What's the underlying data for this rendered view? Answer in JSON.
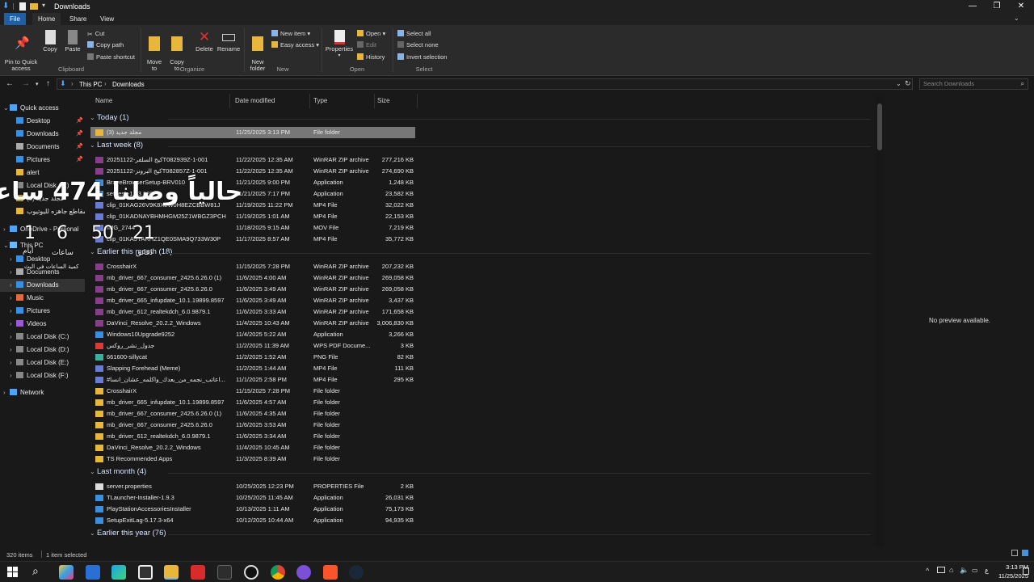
{
  "window": {
    "title": "Downloads"
  },
  "ribbon_tabs": [
    "File",
    "Home",
    "Share",
    "View"
  ],
  "ribbon": {
    "clipboard": {
      "group": "Clipboard",
      "pin": "Pin to Quick\naccess",
      "copy": "Copy",
      "paste": "Paste",
      "cut": "Cut",
      "copy_path": "Copy path",
      "paste_shortcut": "Paste shortcut"
    },
    "organize": {
      "group": "Organize",
      "move_to": "Move\nto",
      "copy_to": "Copy\nto",
      "delete": "Delete",
      "rename": "Rename"
    },
    "new": {
      "group": "New",
      "new_folder": "New\nfolder",
      "new_item": "New item",
      "easy_access": "Easy access"
    },
    "open": {
      "group": "Open",
      "properties": "Properties",
      "open": "Open",
      "edit": "Edit",
      "history": "History"
    },
    "select": {
      "group": "Select",
      "select_all": "Select all",
      "select_none": "Select none",
      "invert": "Invert selection"
    }
  },
  "address": {
    "path": [
      "This PC",
      "Downloads"
    ],
    "search_placeholder": "Search Downloads"
  },
  "nav": {
    "quick_access": "Quick access",
    "quick_items": [
      "Desktop",
      "Downloads",
      "Documents",
      "Pictures",
      "alert",
      "Local Disk (D:)",
      "مجلد جديد (3)",
      "مقاطع جاهزه لليوتيوب"
    ],
    "onedrive": "OneDrive - Personal",
    "this_pc": "This PC",
    "pc_items": [
      "Desktop",
      "Documents",
      "Downloads",
      "Music",
      "Pictures",
      "Videos",
      "Local Disk (C:)",
      "Local Disk (D:)",
      "Local Disk (E:)",
      "Local Disk (F:)"
    ],
    "network": "Network"
  },
  "columns": [
    "Name",
    "Date modified",
    "Type",
    "Size"
  ],
  "groups": [
    {
      "label": "Today (1)",
      "rows": [
        [
          "مجلد جديد (3)",
          "11/25/2025 3:13 PM",
          "File folder",
          ""
        ]
      ]
    },
    {
      "label": "Last week (8)",
      "rows": [
        [
          "20251122-كيج السلفرT082939Z-1-001",
          "11/22/2025 12:35 AM",
          "WinRAR ZIP archive",
          "277,216 KB"
        ],
        [
          "20251122-كيج البرونزT082857Z-1-001",
          "11/22/2025 12:35 AM",
          "WinRAR ZIP archive",
          "274,690 KB"
        ],
        [
          "BraveBrowserSetup-BRV010",
          "11/21/2025 9:00 PM",
          "Application",
          "1,248 KB"
        ],
        [
          "setdesk-1.23.386",
          "11/21/2025 7:17 PM",
          "Application",
          "23,582 KB"
        ],
        [
          "clip_01KAG26V9K8X2W0H8EZCBBW81J",
          "11/19/2025 11:22 PM",
          "MP4 File",
          "32,022 KB"
        ],
        [
          "clip_01KADNAYBHMHGM25Z1WBGZ3PCH",
          "11/19/2025 1:01 AM",
          "MP4 File",
          "22,153 KB"
        ],
        [
          "IMG_2744",
          "11/18/2025 9:15 AM",
          "MOV File",
          "7,219 KB"
        ],
        [
          "clip_01KA5YARHZ1QE0SMA9Q733W30P",
          "11/17/2025 8:57 AM",
          "MP4 File",
          "35,772 KB"
        ]
      ]
    },
    {
      "label": "Earlier this month (18)",
      "rows": [
        [
          "CrosshairX",
          "11/15/2025 7:28 PM",
          "WinRAR ZIP archive",
          "207,232 KB"
        ],
        [
          "mb_driver_667_consumer_2425.6.26.0 (1)",
          "11/6/2025 4:00 AM",
          "WinRAR ZIP archive",
          "269,058 KB"
        ],
        [
          "mb_driver_667_consumer_2425.6.26.0",
          "11/6/2025 3:49 AM",
          "WinRAR ZIP archive",
          "269,058 KB"
        ],
        [
          "mb_driver_665_infupdate_10.1.19899.8597",
          "11/6/2025 3:49 AM",
          "WinRAR ZIP archive",
          "3,437 KB"
        ],
        [
          "mb_driver_612_realtekdch_6.0.9879.1",
          "11/6/2025 3:33 AM",
          "WinRAR ZIP archive",
          "171,658 KB"
        ],
        [
          "DaVinci_Resolve_20.2.2_Windows",
          "11/4/2025 10:43 AM",
          "WinRAR ZIP archive",
          "3,006,830 KB"
        ],
        [
          "Windows10Upgrade9252",
          "11/4/2025 5:22 AM",
          "Application",
          "3,266 KB"
        ],
        [
          "جدول_نشر_روكس",
          "11/2/2025 11:39 AM",
          "WPS PDF Docume...",
          "3 KB"
        ],
        [
          "661600-sillycat",
          "11/2/2025 1:52 AM",
          "PNG File",
          "82 KB"
        ],
        [
          "Slapping Forehead (Meme)",
          "11/2/2025 1:44 AM",
          "MP4 File",
          "111 KB"
        ],
        [
          "#اعاتب_نجمه_من_بعدك_واكلمه_عشان_انسا...",
          "11/1/2025 2:58 PM",
          "MP4 File",
          "295 KB"
        ],
        [
          "CrosshairX",
          "11/15/2025 7:28 PM",
          "File folder",
          ""
        ],
        [
          "mb_driver_665_infupdate_10.1.19899.8597",
          "11/6/2025 4:57 AM",
          "File folder",
          ""
        ],
        [
          "mb_driver_667_consumer_2425.6.26.0 (1)",
          "11/6/2025 4:35 AM",
          "File folder",
          ""
        ],
        [
          "mb_driver_667_consumer_2425.6.26.0",
          "11/6/2025 3:53 AM",
          "File folder",
          ""
        ],
        [
          "mb_driver_612_realtekdch_6.0.9879.1",
          "11/6/2025 3:34 AM",
          "File folder",
          ""
        ],
        [
          "DaVinci_Resolve_20.2.2_Windows",
          "11/4/2025 10:45 AM",
          "File folder",
          ""
        ],
        [
          "TS Recommended Apps",
          "11/3/2025 8:39 AM",
          "File folder",
          ""
        ]
      ]
    },
    {
      "label": "Last month (4)",
      "rows": [
        [
          "server.properties",
          "10/25/2025 12:23 PM",
          "PROPERTIES File",
          "2 KB"
        ],
        [
          "TLauncher-Installer-1.9.3",
          "10/25/2025 11:45 AM",
          "Application",
          "26,031 KB"
        ],
        [
          "PlayStationAccessoriesInstaller",
          "10/13/2025 1:11 AM",
          "Application",
          "75,173 KB"
        ],
        [
          "SetupExitLag-5.17.3-x64",
          "10/12/2025 10:44 AM",
          "Application",
          "94,935 KB"
        ]
      ]
    },
    {
      "label": "Earlier this year (76)",
      "rows": []
    }
  ],
  "preview_text": "No preview available.",
  "status": {
    "items": "320 items",
    "selected": "1 item selected"
  },
  "overlay": {
    "headline": "حالياً وصلنا 474 ساعه",
    "days": "1",
    "hours": "6",
    "minutes": "50",
    "seconds": "21",
    "label_days": "أيام",
    "label_hours": "ساعات",
    "label_minutes": "دقائق",
    "label_caption": "كمية الساعات في البث"
  },
  "clock": {
    "time": "3:13 PM",
    "date": "11/25/2025",
    "lang": "ع"
  },
  "colors": {
    "accent": "#1f5fa6",
    "folder": "#e8b63a",
    "zip": "#8a3d8a",
    "selected": "#777777"
  }
}
